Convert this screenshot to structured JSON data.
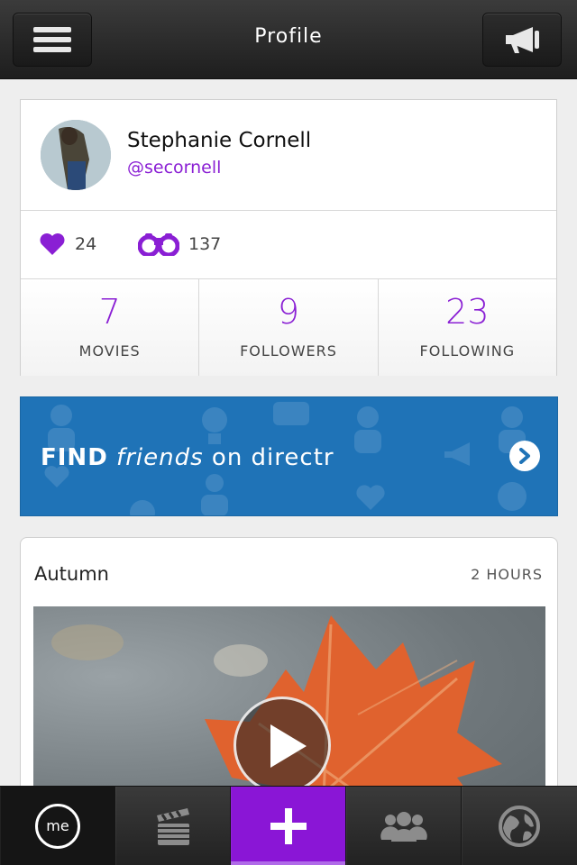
{
  "header": {
    "title": "Profile",
    "menu_icon": "hamburger-menu-icon",
    "action_icon": "megaphone-icon"
  },
  "profile": {
    "name": "Stephanie Cornell",
    "handle": "@secornell",
    "likes_count": "24",
    "views_count": "137",
    "stats": [
      {
        "value": "7",
        "label": "MOVIES"
      },
      {
        "value": "9",
        "label": "FOLLOWERS"
      },
      {
        "value": "23",
        "label": "FOLLOWING"
      }
    ]
  },
  "banner": {
    "find": "FIND",
    "friends": "friends",
    "suffix": "on directr"
  },
  "post": {
    "title": "Autumn",
    "time": "2 HOURS"
  },
  "tabbar": {
    "me_label": "me",
    "tabs": [
      "me-icon",
      "clapperboard-icon",
      "plus-icon",
      "people-icon",
      "globe-icon"
    ]
  },
  "colors": {
    "accent": "#8a1fd4",
    "banner": "#1f73b7",
    "add_tab": "#8a16d6"
  }
}
